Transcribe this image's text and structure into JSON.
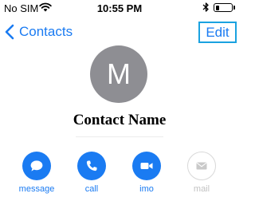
{
  "status_bar": {
    "carrier": "No SIM",
    "time": "10:55 PM",
    "icons": [
      "wifi-icon",
      "bluetooth-icon",
      "battery-icon"
    ],
    "battery_level": 0.25
  },
  "nav": {
    "back_label": "Contacts",
    "back_icon": "chevron-left-icon",
    "edit_label": "Edit"
  },
  "contact": {
    "initial": "M",
    "name": "Contact Name"
  },
  "actions": [
    {
      "label": "message",
      "icon": "message-bubble-icon",
      "enabled": true
    },
    {
      "label": "call",
      "icon": "phone-icon",
      "enabled": true
    },
    {
      "label": "imo",
      "icon": "video-camera-icon",
      "enabled": true
    },
    {
      "label": "mail",
      "icon": "envelope-icon",
      "enabled": false
    }
  ],
  "colors": {
    "accent": "#1a7bf2",
    "edit_highlight": "#1aa2e0",
    "avatar_bg": "#8e8e93",
    "disabled": "#c2c2c2"
  }
}
